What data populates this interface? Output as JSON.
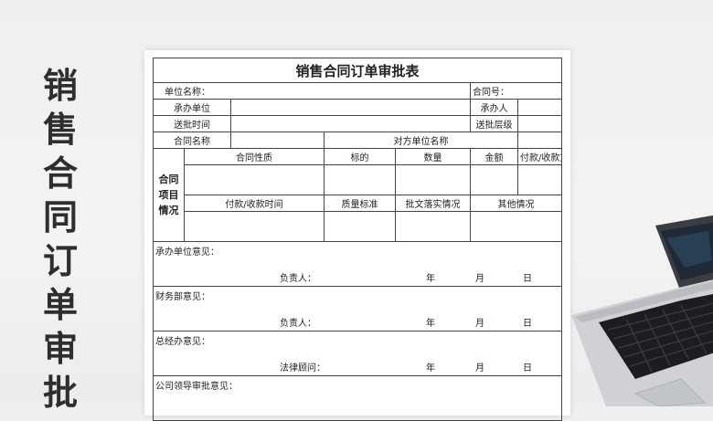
{
  "side_title_chars": [
    "销",
    "售",
    "合",
    "同",
    "订",
    "单",
    "审",
    "批"
  ],
  "form": {
    "title": "销售合同订单审批表",
    "unit_name_label": "单位名称：",
    "contract_no_label": "合同号：",
    "undertaking_unit_label": "承办单位",
    "handler_label": "承办人",
    "submit_time_label": "送批时间",
    "submit_level_label": "送批层级",
    "contract_name_label": "合同名称",
    "counterparty_label": "对方单位名称",
    "group_label_lines": [
      "合同",
      "项目",
      "情况"
    ],
    "row1_headers": [
      "合同性质",
      "标的",
      "数量",
      "金额",
      "付款/收款方式"
    ],
    "row2_headers": [
      "付款/收款时间",
      "质量标准",
      "批文落实情况",
      "其他情况"
    ],
    "opinions": [
      {
        "label": "承办单位意见：",
        "signer": "负责人：",
        "year": "年",
        "month": "月",
        "day": "日"
      },
      {
        "label": "财务部意见：",
        "signer": "负责人：",
        "year": "年",
        "month": "月",
        "day": "日"
      },
      {
        "label": "总经办意见：",
        "signer": "法律顾问：",
        "year": "年",
        "month": "月",
        "day": "日"
      }
    ],
    "leader_opinion_label": "公司领导审批意见："
  }
}
